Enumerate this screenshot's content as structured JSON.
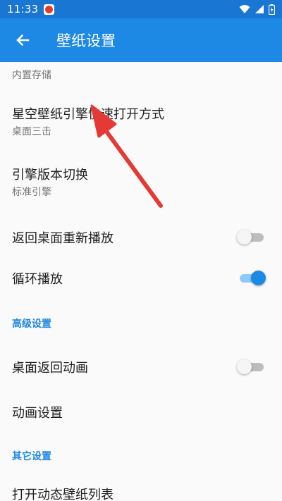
{
  "status_bar": {
    "time": "11:33",
    "notification_icon": "app-badge-icon",
    "icons": [
      "wifi-icon",
      "signal-icon",
      "battery-icon"
    ]
  },
  "app_bar": {
    "title": "壁纸设置",
    "back_icon": "arrow-left-icon"
  },
  "settings": {
    "top_summary": "内置存储",
    "launch_mode": {
      "title": "星空壁纸引擎快速打开方式",
      "summary": "桌面三击"
    },
    "engine_version": {
      "title": "引擎版本切换",
      "summary": "标准引擎"
    },
    "replay_on_return": {
      "title": "返回桌面重新播放",
      "enabled": false
    },
    "loop_play": {
      "title": "循环播放",
      "enabled": true
    },
    "advanced_section": "高级设置",
    "desktop_return_anim": {
      "title": "桌面返回动画",
      "enabled": false
    },
    "anim_settings": {
      "title": "动画设置"
    },
    "other_section": "其它设置",
    "open_live_list": {
      "title": "打开动态壁纸列表"
    }
  },
  "colors": {
    "status_bar": "#1976d2",
    "app_bar": "#1e88e5",
    "accent": "#1e88e5",
    "annotation_arrow": "#e53935"
  }
}
